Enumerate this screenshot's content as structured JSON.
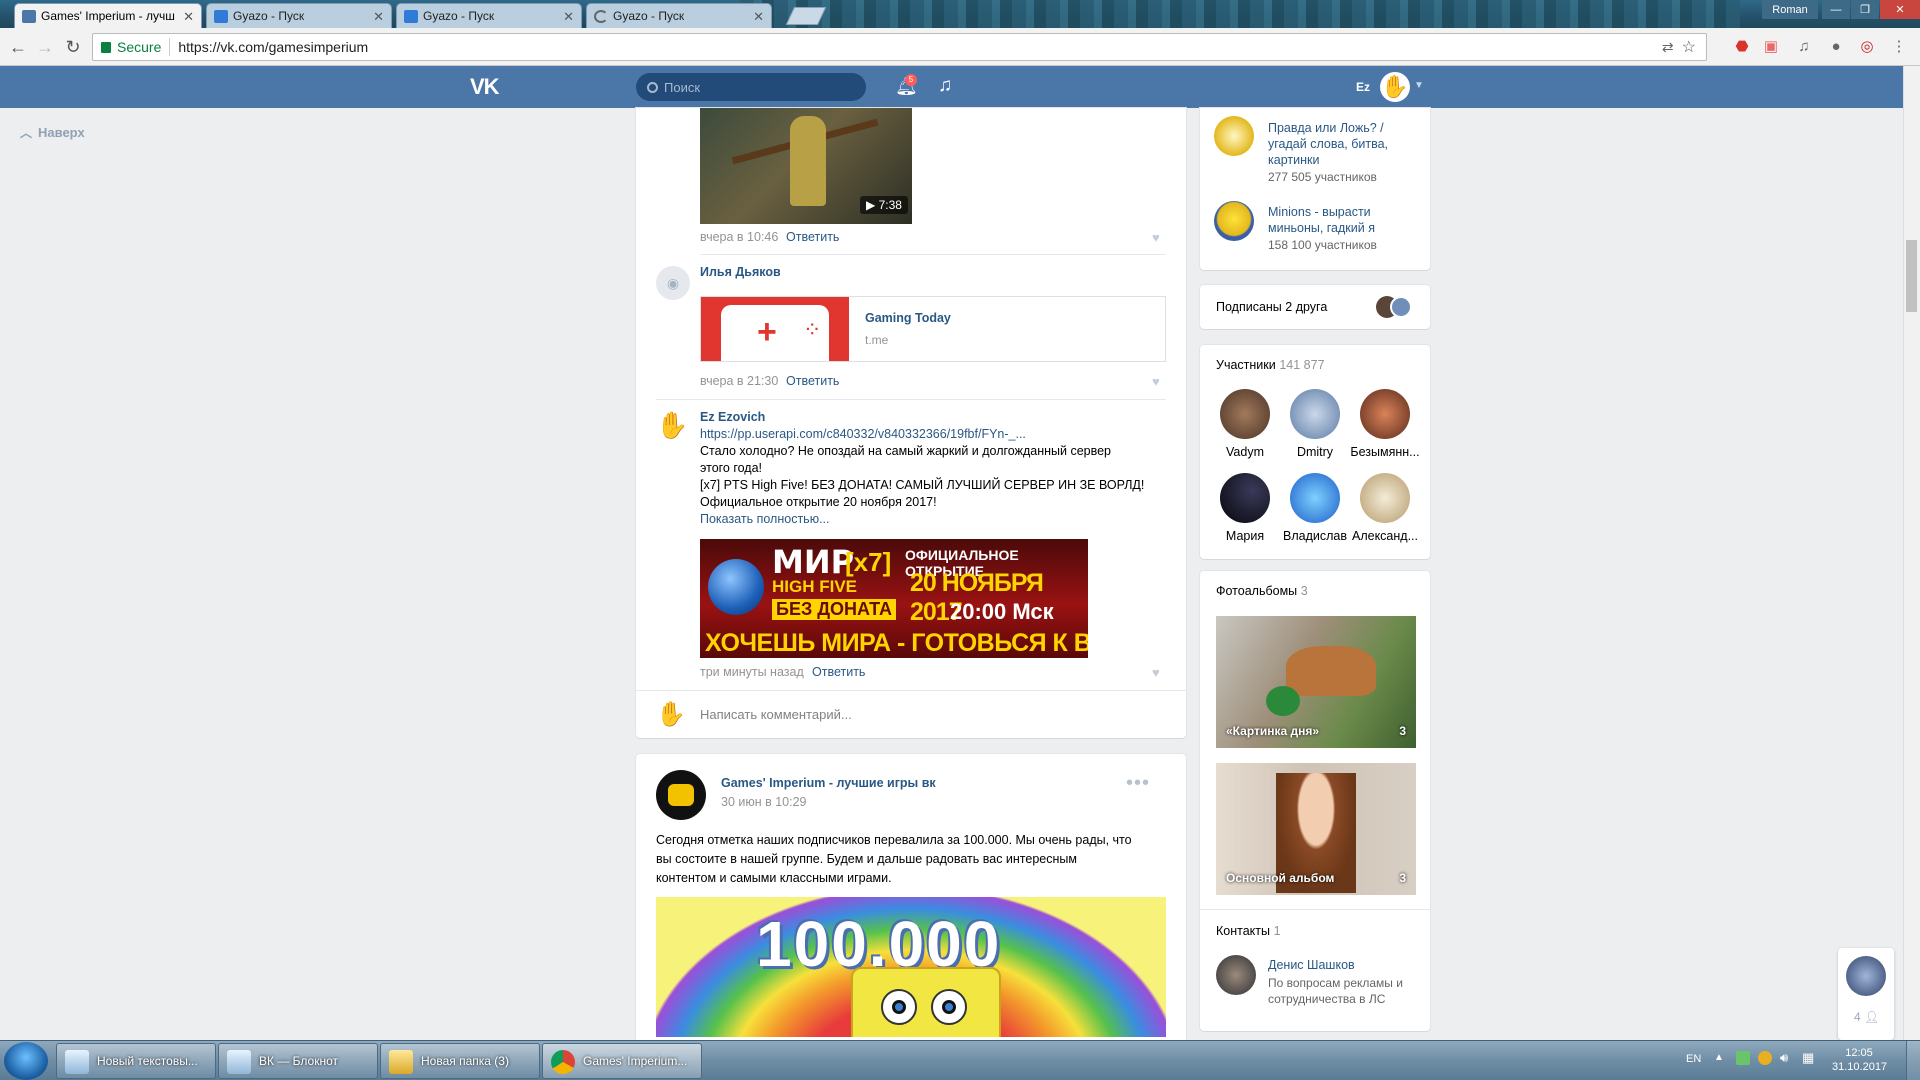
{
  "browser": {
    "tabs": [
      {
        "label": "Games' Imperium - лучш"
      },
      {
        "label": "Gyazo - Пуск"
      },
      {
        "label": "Gyazo - Пуск"
      },
      {
        "label": "Gyazo - Пуск"
      }
    ],
    "user_label": "Roman",
    "secure_label": "Secure",
    "url": "https://vk.com/gamesimperium"
  },
  "vk_header": {
    "logo": "VK",
    "search_placeholder": "Поиск",
    "notif_count": "5",
    "username": "Ez"
  },
  "left": {
    "to_top": "Наверх"
  },
  "comments": [
    {
      "meta": "вчера в 10:46",
      "reply": "Ответить",
      "video_duration": "7:38"
    },
    {
      "author": "Илья Дьяков",
      "link_title": "Gaming Today",
      "link_domain": "t.me",
      "meta": "вчера в 21:30",
      "reply": "Ответить"
    },
    {
      "author": "Ez Ezovich",
      "link": "https://pp.userapi.com/c840332/v840332366/19fbf/FYn-_...",
      "lines": [
        "Стало холодно? Не опоздай на самый жаркий и долгожданный сервер",
        "этого года!",
        "[x7] PTS High Five! БЕЗ ДОНАТА! САМЫЙ ЛУЧШИЙ СЕРВЕР ИН ЗЕ ВОРЛД!",
        "Официальное открытие 20 ноября 2017!"
      ],
      "show_more": "Показать полностью...",
      "banner": {
        "t1": "МИР",
        "t2": "[x7]",
        "t3": "HIGH FIVE",
        "t4": "БЕЗ ДОНАТА",
        "t5": "ОФИЦИАЛЬНОЕ ОТКРЫТИЕ",
        "t6": "20 НОЯБРЯ 2017",
        "t7": "20:00 Мск",
        "t8": "ХОЧЕШЬ МИРА - ГОТОВЬСЯ К ВОЙНЕ"
      },
      "meta": "три минуты назад",
      "reply": "Ответить"
    }
  ],
  "comment_input_placeholder": "Написать комментарий...",
  "post": {
    "author": "Games' Imperium - лучшие игры вк",
    "date": "30 июн в 10:29",
    "text_lines": [
      "Сегодня отметка наших подписчиков перевалила за 100.000. Мы очень рады, что",
      "вы состоите в нашей группе. Будем и дальше радовать вас интересным",
      "контентом и самыми классными играми."
    ],
    "image_number": "100.000"
  },
  "right": {
    "groups": [
      {
        "name_lines": [
          "Правда или Ложь? /",
          "угадай слова, битва,",
          "картинки"
        ],
        "count": "277 505 участников"
      },
      {
        "name_lines": [
          "Minions - вырасти",
          "миньоны, гадкий я"
        ],
        "count": "158 100 участников"
      }
    ],
    "friends_label": "Подписаны 2 друга",
    "members": {
      "title": "Участники",
      "count": "141 877",
      "people": [
        {
          "name": "Vadym",
          "color": "#6b4a3a"
        },
        {
          "name": "Dmitry",
          "color": "#8aa3c4"
        },
        {
          "name": "Безымянн...",
          "color": "#a0522d"
        },
        {
          "name": "Мария",
          "color": "#101018"
        },
        {
          "name": "Владислав",
          "color": "#3a78c8"
        },
        {
          "name": "Александ...",
          "color": "#c9b48a"
        }
      ]
    },
    "albums": {
      "title": "Фотоальбомы",
      "count": "3",
      "items": [
        {
          "caption": "«Картинка дня»",
          "count": "3"
        },
        {
          "caption": "Основной альбом",
          "count": "3"
        }
      ]
    },
    "contacts": {
      "title": "Контакты",
      "count": "1",
      "name": "Денис Шашков",
      "role_lines": [
        "По вопросам рекламы и",
        "сотрудничества в ЛС"
      ]
    }
  },
  "chat_count": "4",
  "taskbar": {
    "tasks": [
      {
        "label": "Новый текстовы..."
      },
      {
        "label": "ВК — Блокнот"
      },
      {
        "label": "Новая папка (3)"
      },
      {
        "label": "Games' Imperium..."
      }
    ],
    "lang": "EN",
    "time": "12:05",
    "date": "31.10.2017"
  },
  "colors": {
    "vk_blue": "#4a76a8",
    "link": "#2a5885",
    "bg": "#edeef0"
  }
}
